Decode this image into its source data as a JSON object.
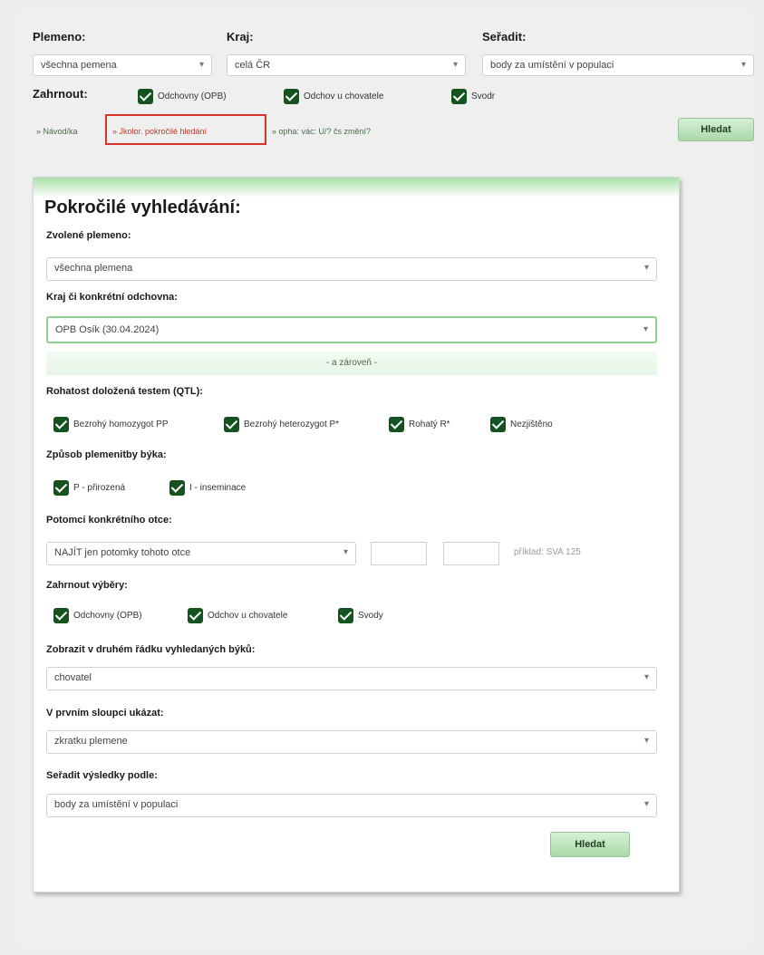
{
  "top": {
    "plemeno_label": "Plemeno:",
    "plemeno_value": "všechna pemena",
    "kraj_label": "Kraj:",
    "kraj_value": "celá ČR",
    "seradit_label": "Seřadit:",
    "seradit_value": "body za umístění v populaci",
    "zahrnout_label": "Zahrnout:",
    "checkboxes": [
      "Odchovny (OPB)",
      "Odchov u chovatele",
      "Svodr"
    ],
    "links": [
      "» Návod/ka",
      "» Jkolor. pokročilé hledání",
      "» opha: vác: U/? čs změní?"
    ],
    "search_button": "Hledat"
  },
  "panel": {
    "title": "Pokročilé vyhledávání:",
    "zvolene_label": "Zvolené plemeno:",
    "zvolene_value": "všechna plemena",
    "kraj_label": "Kraj či konkrétní odchovna:",
    "kraj_value": "OPB Osík (30.04.2024)",
    "zaroven": "- a zároveň -",
    "rohatost_label": "Rohatost doložená testem (QTL):",
    "rohatost_options": [
      "Bezrohý homozygot PP",
      "Bezrohý heterozygot P*",
      "Rohatý R*",
      "Nezjištěno"
    ],
    "zpusob_label": "Způsob plemenitby býka:",
    "zpusob_options": [
      "P - přirozená",
      "I - inseminace"
    ],
    "potomci_label": "Potomci konkrétního otce:",
    "potomci_value": "NAJÍT jen potomky tohoto otce",
    "potomci_hint": "příklad: SVA 125",
    "vybery_label": "Zahrnout výběry:",
    "vybery_options": [
      "Odchovny (OPB)",
      "Odchov u chovatele",
      "Svody"
    ],
    "druhy_label": "Zobrazit v druhém řádku vyhledaných býků:",
    "druhy_value": "chovatel",
    "prvni_label": "V prvním sloupci ukázat:",
    "prvni_value": "zkratku plemene",
    "seradit_label": "Seřadit výsledky podle:",
    "seradit_value": "body za umístění v populaci",
    "search_button": "Hledat"
  },
  "colors": {
    "checkbox": "#14531f",
    "button_top": "#d6f0d6",
    "button_bottom": "#a9d9a9",
    "highlight_border": "#d9342b"
  }
}
